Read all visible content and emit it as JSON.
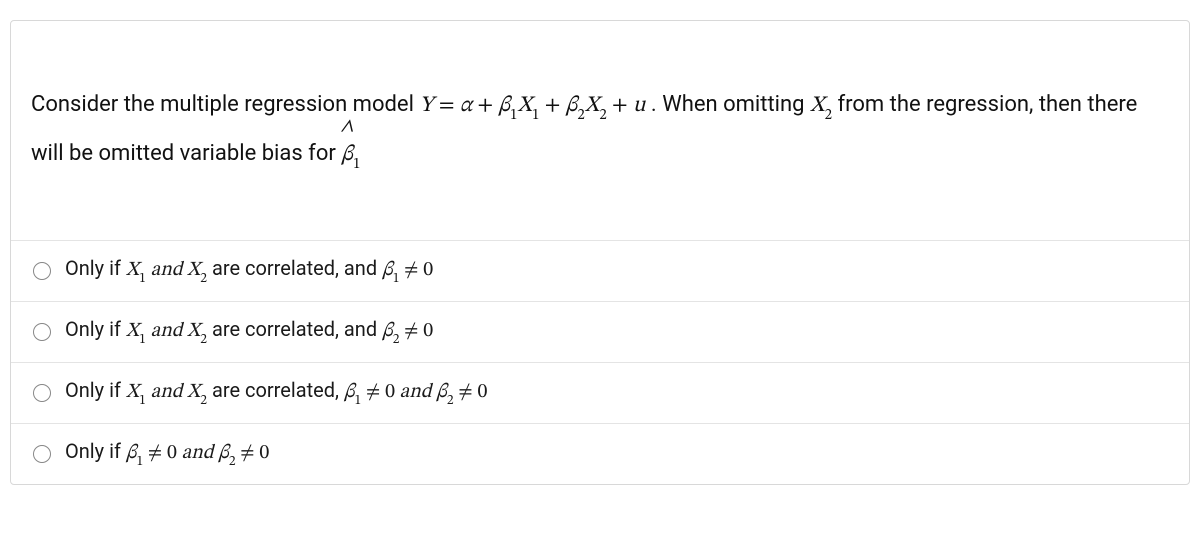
{
  "question": {
    "prefix": "Consider the multiple regression model ",
    "eq_Y": "Y",
    "eq_eq": " = ",
    "eq_alpha": "α",
    "eq_plus1": " + ",
    "eq_b1": "β",
    "eq_b1_sub": "1",
    "eq_X1": "X",
    "eq_X1_sub": "1",
    "eq_plus2": " + ",
    "eq_b2": "β",
    "eq_b2_sub": "2",
    "eq_X2": "X",
    "eq_X2_sub": "2",
    "eq_plus3": " + ",
    "eq_u": "u",
    "eq_dot": " . ",
    "middle": "When omitting ",
    "eq_X2b": "X",
    "eq_X2b_sub": "2",
    "after": " from the regression, then there will be omitted variable bias for ",
    "hat": "∧",
    "bhat": "β",
    "bhat_sub": "1"
  },
  "answers": [
    {
      "lead": "Only if ",
      "x1": "X",
      "x1s": "1",
      "and1": " and ",
      "x2": "X",
      "x2s": "2",
      "mid": " are correlated, and ",
      "b": "β",
      "bs": "1",
      "neq": " ≠ 0"
    },
    {
      "lead": "Only if ",
      "x1": "X",
      "x1s": "1",
      "and1": " and ",
      "x2": "X",
      "x2s": "2",
      "mid": " are correlated, and ",
      "b": "β",
      "bs": "2",
      "neq": " ≠ 0"
    },
    {
      "lead": "Only if ",
      "x1": "X",
      "x1s": "1",
      "and1": " and ",
      "x2": "X",
      "x2s": "2",
      "mid": " are correlated, ",
      "b": "β",
      "bs": "1",
      "neq": " ≠ 0",
      "and2": " and ",
      "b2": "β",
      "b2s": "2",
      "neq2": " ≠ 0"
    },
    {
      "lead": "Only if ",
      "b": "β",
      "bs": "1",
      "neq": " ≠ 0",
      "and2": " and ",
      "b2": "β",
      "b2s": "2",
      "neq2": " ≠ 0"
    }
  ]
}
